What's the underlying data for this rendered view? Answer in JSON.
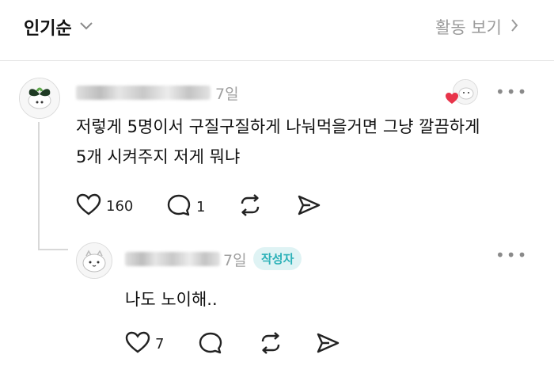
{
  "header": {
    "sort_label": "인기순",
    "activity_label": "활동 보기"
  },
  "comment": {
    "time": "7일",
    "text_line1": "저렇게 5명이서 구질구질하게 나눠먹을거면 그냥 깔끔하게",
    "text_line2": "5개 시켜주지 저게 뭐냐",
    "like_count": "160",
    "reply_count": "1",
    "more": "•••"
  },
  "reply": {
    "time": "7일",
    "badge": "작성자",
    "text": "나도 노이해..",
    "like_count": "7",
    "more": "•••"
  },
  "colors": {
    "heart_badge": "#e8344a",
    "badge_bg": "#dff3f4",
    "badge_text": "#2bb1b8"
  }
}
